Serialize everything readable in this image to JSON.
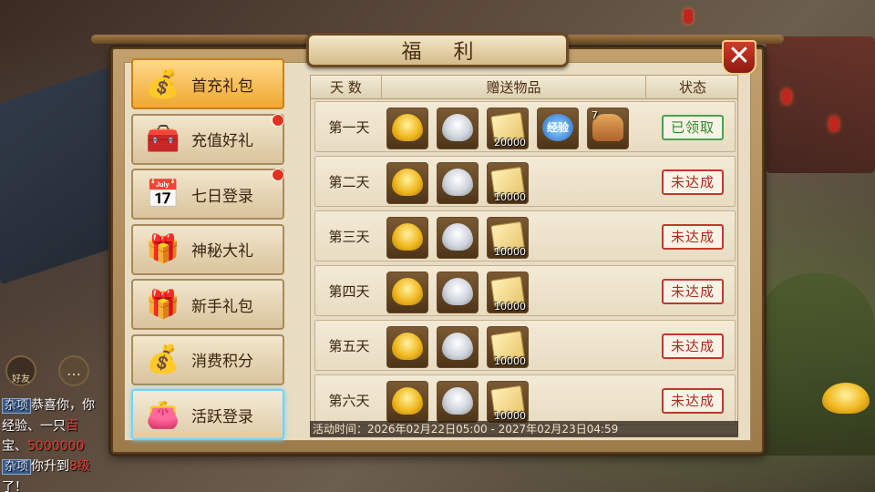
{
  "window": {
    "title": "福 利",
    "close_label": "✕"
  },
  "sidebar": {
    "items": [
      {
        "label": "首充礼包",
        "icon": "money-bag-icon",
        "glyph": "💰",
        "state": "active",
        "badge": false
      },
      {
        "label": "充值好礼",
        "icon": "treasure-chest-icon",
        "glyph": "🧰",
        "state": "normal",
        "badge": true
      },
      {
        "label": "七日登录",
        "icon": "calendar-7-icon",
        "glyph": "📅",
        "state": "normal",
        "badge": true
      },
      {
        "label": "神秘大礼",
        "icon": "gold-chest-icon",
        "glyph": "🎁",
        "state": "normal",
        "badge": false
      },
      {
        "label": "新手礼包",
        "icon": "gift-box-icon",
        "glyph": "🎁",
        "state": "normal",
        "badge": false
      },
      {
        "label": "消费积分",
        "icon": "coin-bag-icon",
        "glyph": "💰",
        "state": "normal",
        "badge": false
      },
      {
        "label": "活跃登录",
        "icon": "red-pouch-icon",
        "glyph": "👛",
        "state": "selected",
        "badge": false
      }
    ]
  },
  "table": {
    "headers": {
      "day": "天 数",
      "items": "赠送物品",
      "status": "状态"
    },
    "rows": [
      {
        "day": "第一天",
        "status": "已领取",
        "status_type": "done",
        "items": [
          {
            "type": "gold-ingot"
          },
          {
            "type": "silver-ingot"
          },
          {
            "type": "scroll",
            "qty": "20000"
          },
          {
            "type": "exp",
            "text": "经验"
          },
          {
            "type": "deer",
            "level": "7"
          }
        ]
      },
      {
        "day": "第二天",
        "status": "未达成",
        "status_type": "pending",
        "items": [
          {
            "type": "gold-ingot"
          },
          {
            "type": "silver-ingot"
          },
          {
            "type": "scroll",
            "qty": "10000"
          }
        ]
      },
      {
        "day": "第三天",
        "status": "未达成",
        "status_type": "pending",
        "items": [
          {
            "type": "gold-ingot"
          },
          {
            "type": "silver-ingot"
          },
          {
            "type": "scroll",
            "qty": "10000"
          }
        ]
      },
      {
        "day": "第四天",
        "status": "未达成",
        "status_type": "pending",
        "items": [
          {
            "type": "gold-ingot"
          },
          {
            "type": "silver-ingot"
          },
          {
            "type": "scroll",
            "qty": "10000"
          }
        ]
      },
      {
        "day": "第五天",
        "status": "未达成",
        "status_type": "pending",
        "items": [
          {
            "type": "gold-ingot"
          },
          {
            "type": "silver-ingot"
          },
          {
            "type": "scroll",
            "qty": "10000"
          }
        ]
      },
      {
        "day": "第六天",
        "status": "未达成",
        "status_type": "pending",
        "items": [
          {
            "type": "gold-ingot"
          },
          {
            "type": "silver-ingot"
          },
          {
            "type": "scroll",
            "qty": "10000"
          }
        ]
      }
    ],
    "footer": "活动时间：2026年02月22日05:00 - 2027年02月23日04:59"
  },
  "hud": {
    "friend_label": "好友",
    "chat_lines": [
      {
        "tag": "杂项",
        "parts": [
          {
            "text": "恭喜你，你",
            "color": "white"
          }
        ]
      },
      {
        "tag": "",
        "parts": [
          {
            "text": "经验、一只",
            "color": "white"
          },
          {
            "text": "百",
            "color": "red"
          }
        ]
      },
      {
        "tag": "",
        "parts": [
          {
            "text": "宝、",
            "color": "white"
          },
          {
            "text": "5000000",
            "color": "red"
          }
        ]
      },
      {
        "tag": "杂项",
        "parts": [
          {
            "text": "你升到",
            "color": "white"
          },
          {
            "text": "8级",
            "color": "red"
          },
          {
            "text": "了！",
            "color": "white"
          }
        ]
      }
    ]
  },
  "colors": {
    "accent": "#f0a830",
    "pending": "#b0291f",
    "done": "#2e8a2e",
    "selected_glow": "#6fd4ff"
  }
}
